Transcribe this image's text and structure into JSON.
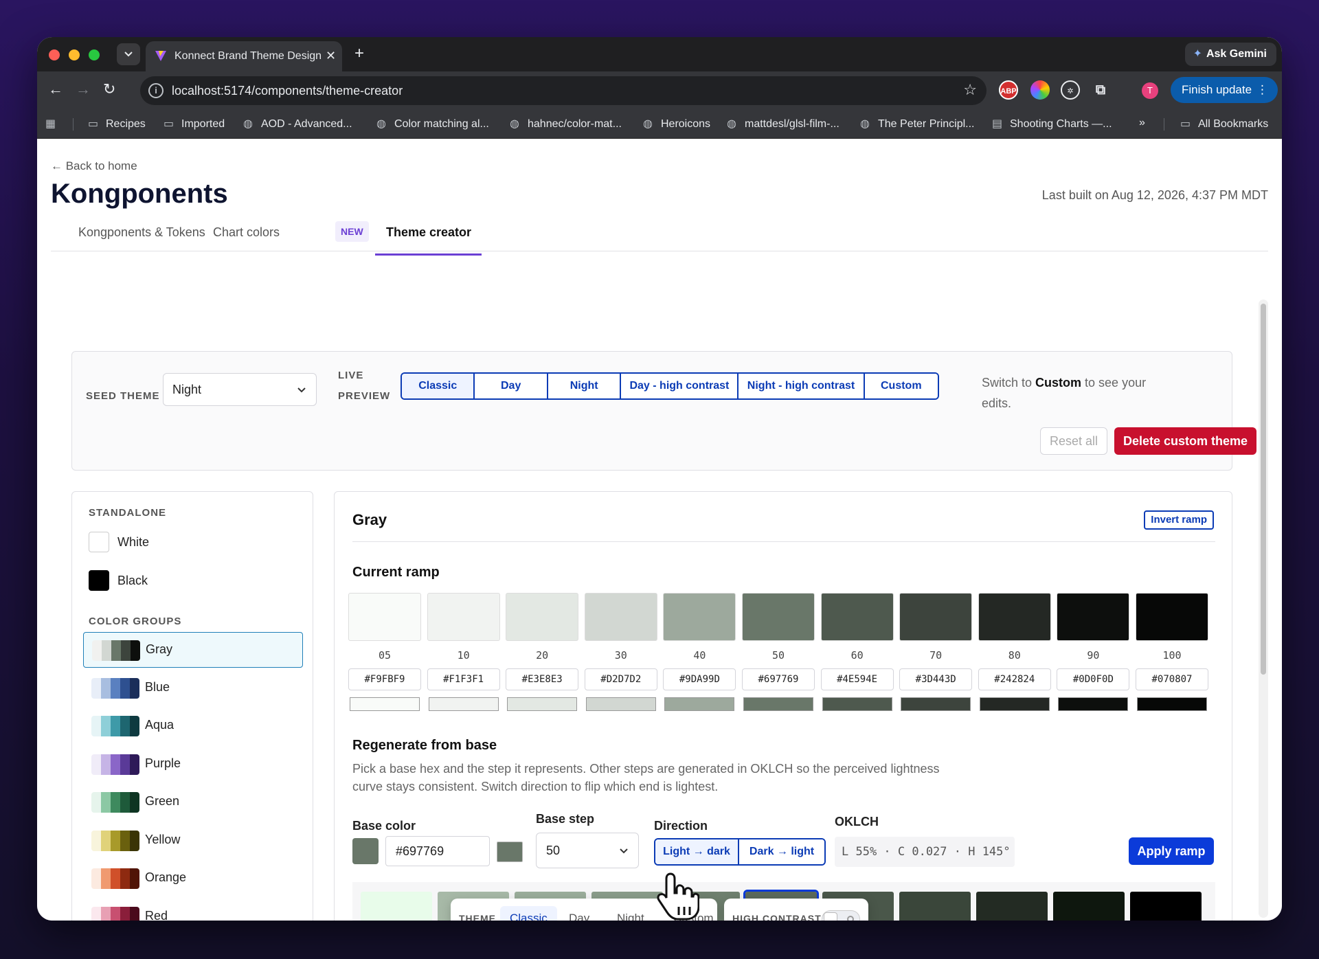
{
  "browser": {
    "tab_title": "Konnect Brand Theme Design",
    "tab_list_icon": "chevron-down-icon",
    "new_tab_icon": "+",
    "close_icon": "✕",
    "ask_label": "Ask Gemini",
    "url": "localhost:5174/components/theme-creator",
    "avatar_letter": "T",
    "finish_label": "Finish update",
    "bookmarks": [
      {
        "label": "Recipes",
        "icon": "folder-icon"
      },
      {
        "label": "Imported",
        "icon": "folder-icon"
      },
      {
        "label": "AOD - Advanced...",
        "icon": "globe-icon"
      },
      {
        "label": "Color matching al...",
        "icon": "globe-icon"
      },
      {
        "label": "hahnec/color-mat...",
        "icon": "globe-icon"
      },
      {
        "label": "Heroicons",
        "icon": "globe-icon"
      },
      {
        "label": "mattdesl/glsl-film-...",
        "icon": "globe-icon"
      },
      {
        "label": "The Peter Principl...",
        "icon": "globe-icon"
      },
      {
        "label": "Shooting Charts —...",
        "icon": "page-icon"
      }
    ],
    "overflow_label": "»",
    "all_bookmarks": "All Bookmarks"
  },
  "page": {
    "back_link": "← Back to home",
    "title": "Kongponents",
    "last_built": "Last built on Aug 12, 2026, 4:37 PM MDT",
    "tabs": [
      {
        "label": "Kongponents & Tokens"
      },
      {
        "label": "Chart colors"
      },
      {
        "label": "Theme creator"
      }
    ],
    "new_badge": "NEW"
  },
  "seed": {
    "seed_label": "SEED THEME",
    "seed_value": "Night",
    "live_label_1": "LIVE",
    "live_label_2": "PREVIEW",
    "preview_options": [
      "Classic",
      "Day",
      "Night",
      "Day - high contrast",
      "Night - high contrast",
      "Custom"
    ],
    "selected_preview": "Classic",
    "hint_1": "Switch to ",
    "hint_bold": "Custom",
    "hint_2": " to see your edits.",
    "reset_label": "Reset all",
    "delete_label": "Delete custom theme"
  },
  "sidebar": {
    "standalone_label": "STANDALONE",
    "standalone": [
      {
        "label": "White",
        "color": "#FFFFFF"
      },
      {
        "label": "Black",
        "color": "#000000"
      }
    ],
    "groups_label": "COLOR GROUPS",
    "groups": [
      {
        "label": "Gray",
        "colors": [
          "#F1F1EF",
          "#D2D7D2",
          "#697769",
          "#3D443D",
          "#0D0F0D"
        ]
      },
      {
        "label": "Blue",
        "colors": [
          "#E8EEF8",
          "#A8BEE0",
          "#5A80C0",
          "#2E5090",
          "#1A2E5A"
        ]
      },
      {
        "label": "Aqua",
        "colors": [
          "#E6F4F6",
          "#8ECFD8",
          "#3E9AA8",
          "#1E6670",
          "#0E3A40"
        ]
      },
      {
        "label": "Purple",
        "colors": [
          "#F0ECF8",
          "#C6B4E6",
          "#8A66C8",
          "#5A3A98",
          "#2E1A58"
        ]
      },
      {
        "label": "Green",
        "colors": [
          "#E6F4EC",
          "#8CC8A4",
          "#3E8A5E",
          "#1E5A3A",
          "#0E3422"
        ]
      },
      {
        "label": "Yellow",
        "colors": [
          "#F8F4DC",
          "#E0D27A",
          "#A89A2A",
          "#6A600E",
          "#3A3406"
        ]
      },
      {
        "label": "Orange",
        "colors": [
          "#FCEAE0",
          "#F09A70",
          "#D0502A",
          "#8E2A10",
          "#501406"
        ]
      },
      {
        "label": "Red",
        "colors": [
          "#FBE8EE",
          "#E8A0B4",
          "#C85070",
          "#8A1E3A",
          "#4A0A1C"
        ]
      }
    ]
  },
  "editor": {
    "group_title": "Gray",
    "invert_label": "Invert ramp",
    "current_ramp_label": "Current ramp",
    "ramp": [
      {
        "step": "05",
        "hex": "#F9FBF9",
        "color": "#F9FBF9"
      },
      {
        "step": "10",
        "hex": "#F1F3F1",
        "color": "#F1F3F1"
      },
      {
        "step": "20",
        "hex": "#E3E8E3",
        "color": "#E3E8E3"
      },
      {
        "step": "30",
        "hex": "#D2D7D2",
        "color": "#D2D7D2"
      },
      {
        "step": "40",
        "hex": "#9DA99D",
        "color": "#9DA99D"
      },
      {
        "step": "50",
        "hex": "#697769",
        "color": "#697769"
      },
      {
        "step": "60",
        "hex": "#4E594E",
        "color": "#4E594E"
      },
      {
        "step": "70",
        "hex": "#3D443D",
        "color": "#3D443D"
      },
      {
        "step": "80",
        "hex": "#242824",
        "color": "#242824"
      },
      {
        "step": "90",
        "hex": "#0D0F0D",
        "color": "#0D0F0D"
      },
      {
        "step": "100",
        "hex": "#070807",
        "color": "#070807"
      }
    ],
    "regen_title": "Regenerate from base",
    "regen_desc": "Pick a base hex and the step it represents. Other steps are generated in OKLCH so the perceived lightness curve stays consistent. Switch direction to flip which end is lightest.",
    "base_color_label": "Base color",
    "base_color_value": "#697769",
    "base_step_label": "Base step",
    "base_step_value": "50",
    "direction_label": "Direction",
    "direction_options": [
      "Light → dark",
      "Dark → light"
    ],
    "selected_direction": "Light → dark",
    "oklch_label": "OKLCH",
    "oklch_value": "L 55% · C 0.027 · H 145°",
    "apply_label": "Apply ramp",
    "preview_colors": [
      "#E8FCEA",
      "#A7B9A7",
      "#9BAE9B",
      "#8A9C8A",
      "#6F806F",
      "#5C6A5C",
      "#4A574A",
      "#3A463A",
      "#232B23",
      "#0E170E",
      "#000000"
    ]
  },
  "floating": {
    "theme_label": "THEME",
    "theme_options": [
      "Classic",
      "Day",
      "Night",
      "Custom"
    ],
    "selected_theme": "Classic",
    "contrast_label": "HIGH CONTRAST"
  }
}
